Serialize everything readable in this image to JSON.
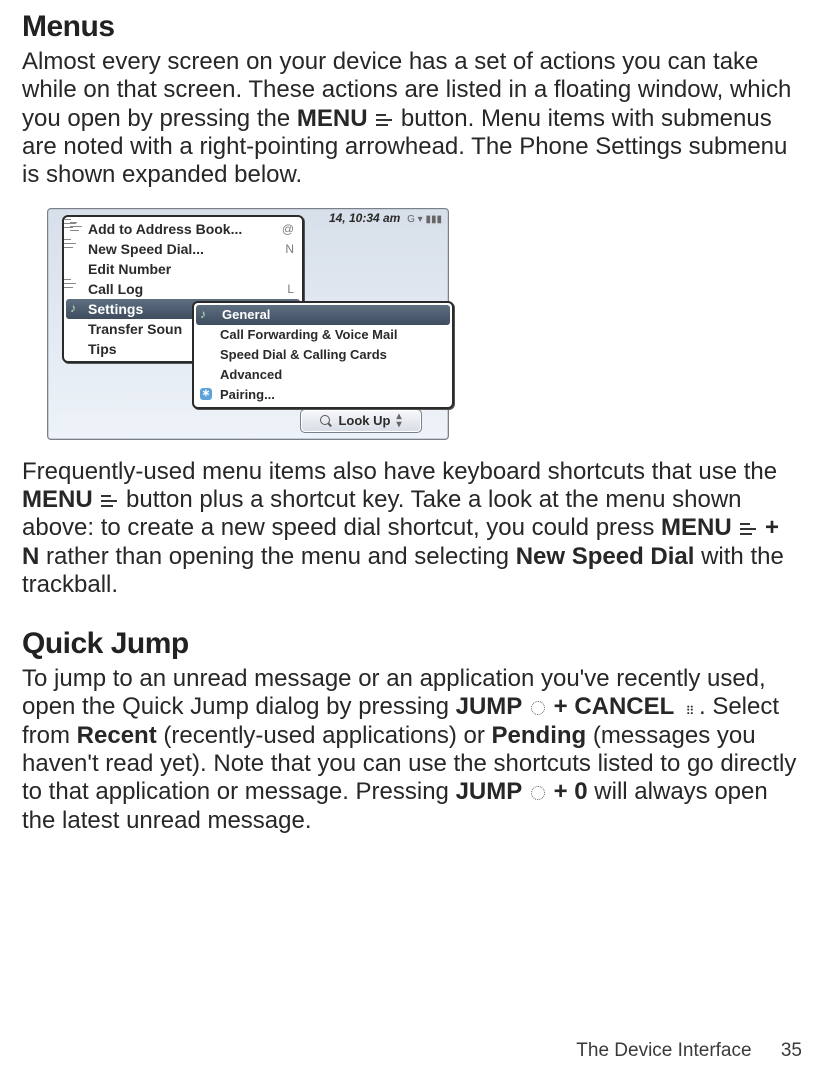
{
  "section1": {
    "title": "Menus",
    "p1a": "Almost every screen on your device has a set of actions you can take while on that screen. These actions are listed in a floating window, which you open by pressing the ",
    "menu_word": "MENU",
    "p1b": " button. Menu items with submenus are noted with a right-pointing arrowhead. The Phone Settings submenu is shown expanded below.",
    "p2a": "Frequently-used menu items also have keyboard shortcuts that use the ",
    "p2b": " button plus a shortcut key. Take a look at the menu shown above: to create a new speed dial shortcut, you could press ",
    "p2c": " + N",
    "p2d": " rather than opening the menu and selecting ",
    "new_speed_dial": "New Speed Dial",
    "p2e": " with the trackball."
  },
  "screenshot": {
    "time": "14, 10:34 am",
    "menu": {
      "add_to_ab": "Add to Address Book...",
      "add_shortcut": "@",
      "new_speed": "New Speed Dial...",
      "new_speed_shortcut": "N",
      "edit_number": "Edit Number",
      "call_log": "Call Log",
      "call_log_shortcut": "L",
      "settings": "Settings",
      "transfer": "Transfer Soun",
      "tips": "Tips"
    },
    "submenu": {
      "general": "General",
      "cf": "Call Forwarding & Voice Mail",
      "speed": "Speed Dial & Calling Cards",
      "advanced": "Advanced",
      "pairing": "Pairing..."
    },
    "lookup": "Look Up"
  },
  "section2": {
    "title": "Quick Jump",
    "p1a": "To jump to an unread message or an application you've recently used, open the Quick Jump dialog by pressing ",
    "jump_word": "JUMP",
    "plus": " + ",
    "cancel_word": "CANCEL",
    "p1a2": ". Select from ",
    "recent": "Recent",
    "p1b": " (recently-used applications) or ",
    "pending": "Pending",
    "p1c": " (messages you haven't read yet). Note that you can use the shortcuts listed to go directly to that application or message. Pressing ",
    "p1d": " + 0",
    "p1e": " will always open the latest unread message."
  },
  "footer": {
    "label": "The Device Interface",
    "page": "35"
  }
}
